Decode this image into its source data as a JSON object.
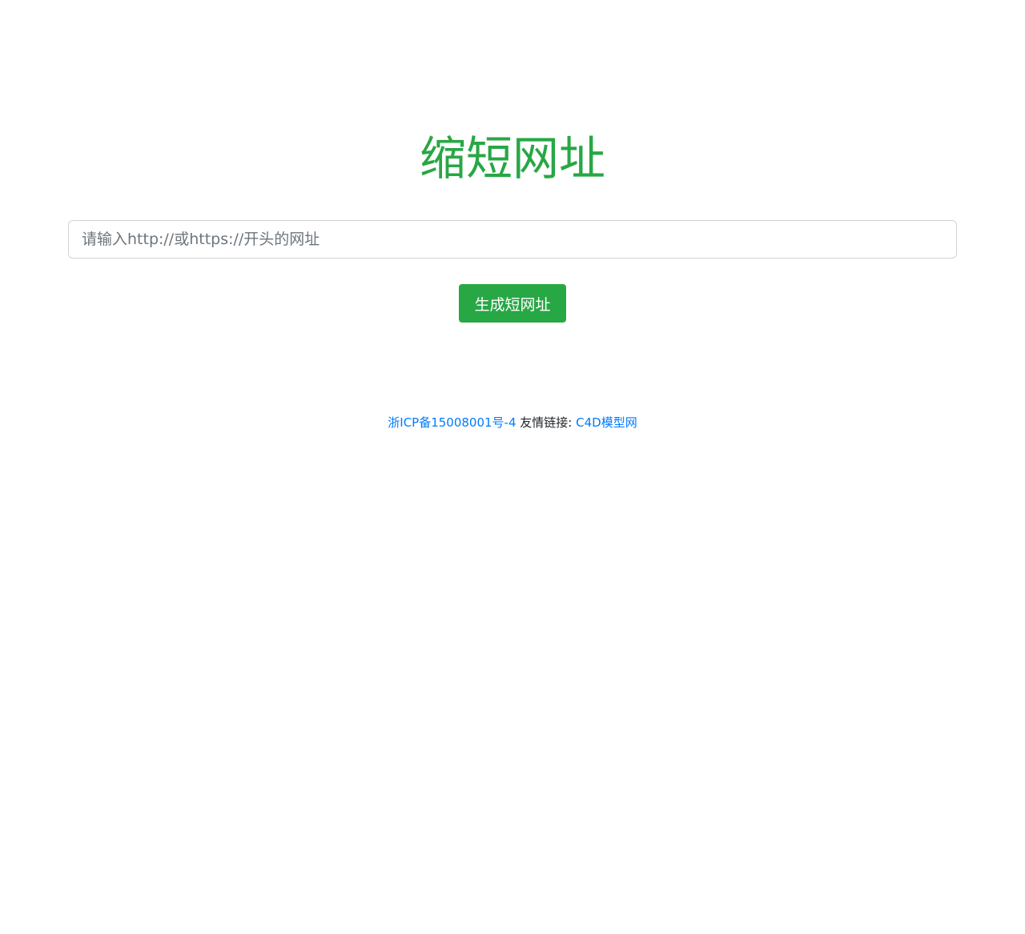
{
  "colors": {
    "accent": "#28a745",
    "link": "#007bff",
    "text": "#212529"
  },
  "header": {
    "title": "缩短网址"
  },
  "form": {
    "url_placeholder": "请输入http://或https://开头的网址",
    "url_value": "",
    "submit_label": "生成短网址"
  },
  "footer": {
    "icp_label": "浙ICP备15008001号-4",
    "friend_links_label": "友情链接:",
    "friend_link_text": "C4D模型网"
  }
}
